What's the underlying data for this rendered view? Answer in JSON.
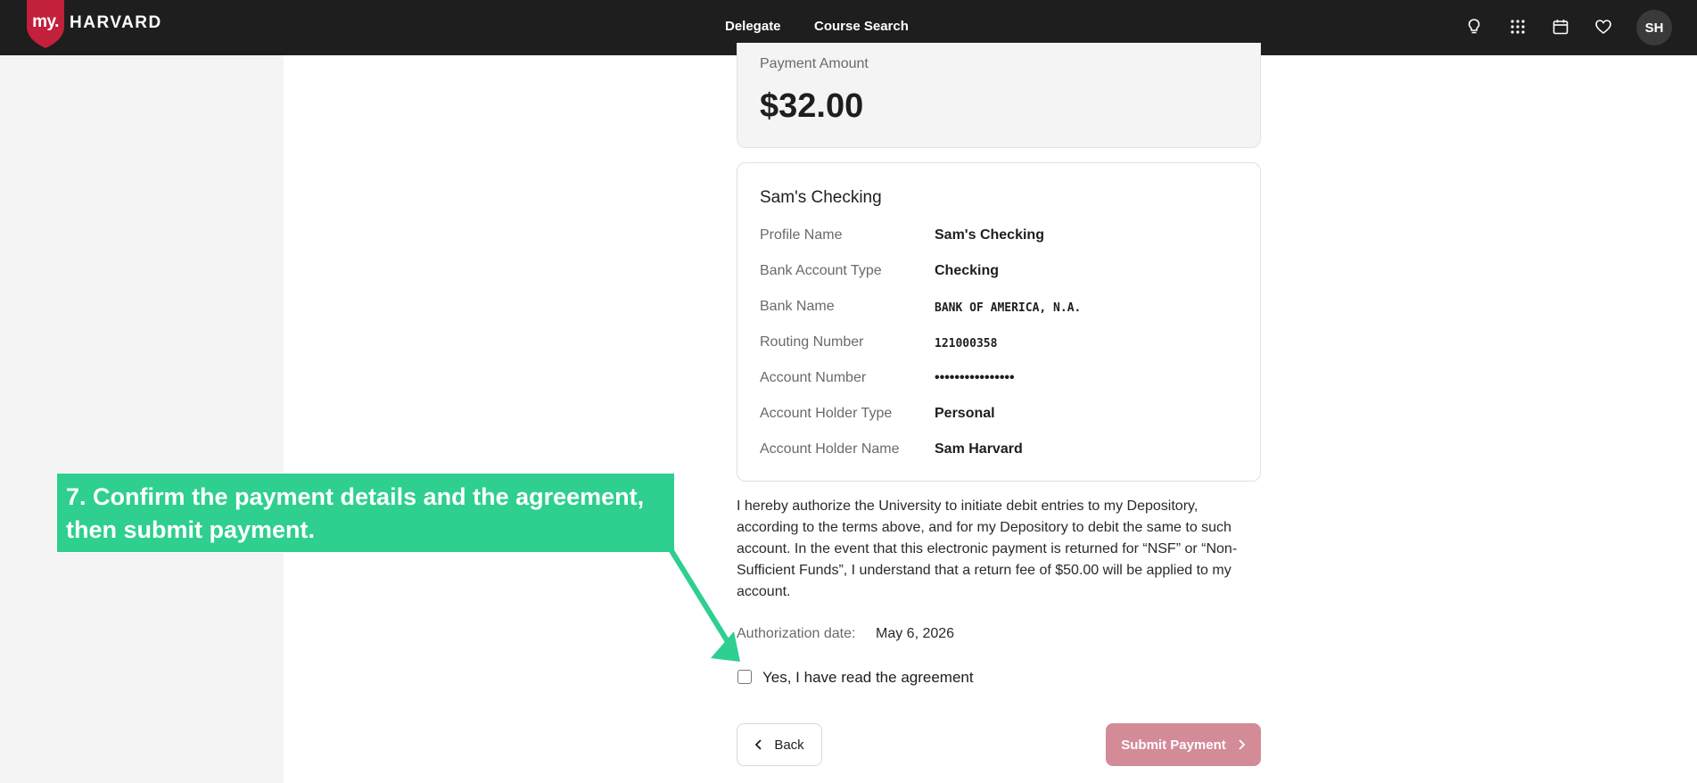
{
  "header": {
    "logo_prefix": "my.",
    "logo_name": "HARVARD",
    "nav": [
      "Delegate",
      "Course Search"
    ],
    "icons": [
      "lightbulb-icon",
      "apps-grid-icon",
      "calendar-icon",
      "heart-icon"
    ],
    "avatar_initials": "SH",
    "brand_color": "#c2203b"
  },
  "payment": {
    "amount_label": "Payment Amount",
    "amount_value": "$32.00"
  },
  "account": {
    "title": "Sam's Checking",
    "rows": [
      {
        "label": "Profile Name",
        "value": "Sam's Checking"
      },
      {
        "label": "Bank Account Type",
        "value": "Checking"
      },
      {
        "label": "Bank Name",
        "value": "BANK OF AMERICA, N.A."
      },
      {
        "label": "Routing Number",
        "value": "121000358"
      },
      {
        "label": "Account Number",
        "value": "••••••••••••••••"
      },
      {
        "label": "Account Holder Type",
        "value": "Personal"
      },
      {
        "label": "Account Holder Name",
        "value": "Sam Harvard"
      }
    ]
  },
  "agreement": {
    "text": "I hereby authorize the University to initiate debit entries to my Depository, according to the terms above, and for my Depository to debit the same to such account. In the event that this electronic payment is returned for “NSF” or “Non-Sufficient Funds”, I understand that a return fee of $50.00 will be applied to my account.",
    "auth_label": "Authorization date:",
    "auth_date": "May 6, 2026",
    "checkbox_label": "Yes, I have read the agreement",
    "checked": false
  },
  "actions": {
    "back_label": "Back",
    "submit_label": "Submit Payment"
  },
  "tutorial": {
    "step_text": "7. Confirm the payment details and the agreement, then submit payment.",
    "callout_color": "#2ecf8f"
  }
}
